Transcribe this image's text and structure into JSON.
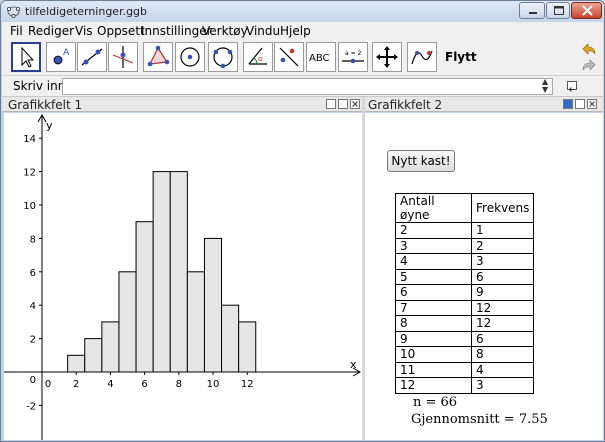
{
  "window": {
    "title": "tilfeldigeterninger.ggb"
  },
  "menu": [
    "Fil",
    "Rediger",
    "Vis",
    "Oppsett",
    "Innstillinger",
    "Verktøy",
    "Vindu",
    "Hjelp"
  ],
  "toolbar": {
    "active_tool_name": "Flytt",
    "tools": [
      "move-tool-icon",
      "point-tool-icon",
      "line-tool-icon",
      "perpendicular-line-tool-icon",
      "polygon-tool-icon",
      "circle-tool-icon",
      "circle-three-points-tool-icon",
      "angle-tool-icon",
      "reflect-tool-icon",
      "text-tool-icon",
      "slider-tool-icon",
      "move-view-tool-icon",
      "locus-tool-icon"
    ],
    "text_tool_label": "ABC",
    "slider_tool_label": "a = 2"
  },
  "inputbar": {
    "label": "Skriv inn:",
    "value": ""
  },
  "panels": {
    "graphics1_title": "Grafikkfelt 1",
    "graphics2_title": "Grafikkfelt 2"
  },
  "graphics2": {
    "button_label": "Nytt kast!",
    "table": {
      "headers": [
        "Antall øyne",
        "Frekvens"
      ],
      "rows": [
        [
          "2",
          "1"
        ],
        [
          "3",
          "2"
        ],
        [
          "4",
          "3"
        ],
        [
          "5",
          "6"
        ],
        [
          "6",
          "9"
        ],
        [
          "7",
          "12"
        ],
        [
          "8",
          "12"
        ],
        [
          "9",
          "6"
        ],
        [
          "10",
          "8"
        ],
        [
          "11",
          "4"
        ],
        [
          "12",
          "3"
        ]
      ]
    },
    "n_text": "n = 66",
    "mean_text": "Gjennomsnitt = 7.55"
  },
  "chart_data": {
    "type": "bar",
    "categories": [
      "2",
      "3",
      "4",
      "5",
      "6",
      "7",
      "8",
      "9",
      "10",
      "11",
      "12"
    ],
    "values": [
      1,
      2,
      3,
      6,
      9,
      12,
      12,
      6,
      8,
      4,
      3
    ],
    "bar_width": 1,
    "xlabel": "x",
    "ylabel": "y",
    "xlim": [
      -2,
      12.8
    ],
    "ylim": [
      -3,
      15.5
    ],
    "x_ticks": [
      "0",
      "2",
      "4",
      "6",
      "8",
      "10",
      "12"
    ],
    "y_ticks": [
      "-2",
      "0",
      "2",
      "4",
      "6",
      "8",
      "10",
      "12",
      "14"
    ],
    "x_tick_values": [
      0,
      2,
      4,
      6,
      8,
      10,
      12
    ],
    "y_tick_values": [
      -2,
      0,
      2,
      4,
      6,
      8,
      10,
      12,
      14
    ],
    "bar_fill": "#e6e6e6",
    "bar_stroke": "#000000",
    "grid": false
  }
}
